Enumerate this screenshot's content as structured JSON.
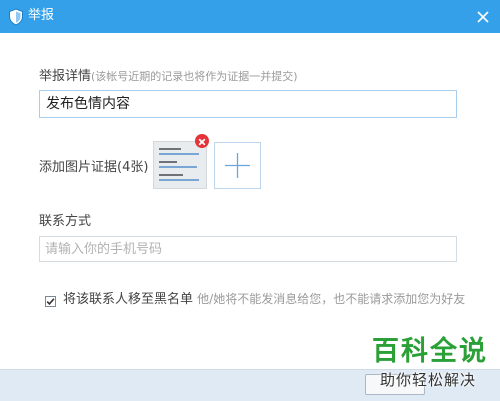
{
  "window": {
    "title": "举报",
    "app_icon": "shield-icon",
    "close_icon": "close-icon",
    "title_bar_color": "#34a0ea"
  },
  "report_details": {
    "label": "举报详情",
    "hint": "(该帐号近期的记录也将作为证据一并提交)",
    "value": "发布色情内容"
  },
  "image_evidence": {
    "label": "添加图片证据(4张)",
    "remove_icon": "remove-icon",
    "add_icon": "plus-icon"
  },
  "contact": {
    "label": "联系方式",
    "placeholder": "请输入你的手机号码"
  },
  "blacklist": {
    "checked": true,
    "label": "将该联系人移至黑名单",
    "note": "他/她将不能发消息给您，也不能请求添加您为好友"
  },
  "watermark": {
    "title": "百科全说",
    "subtitle": "助你轻松解决"
  },
  "accent_color": "#34a0ea",
  "watermark_color": "#2aa037"
}
